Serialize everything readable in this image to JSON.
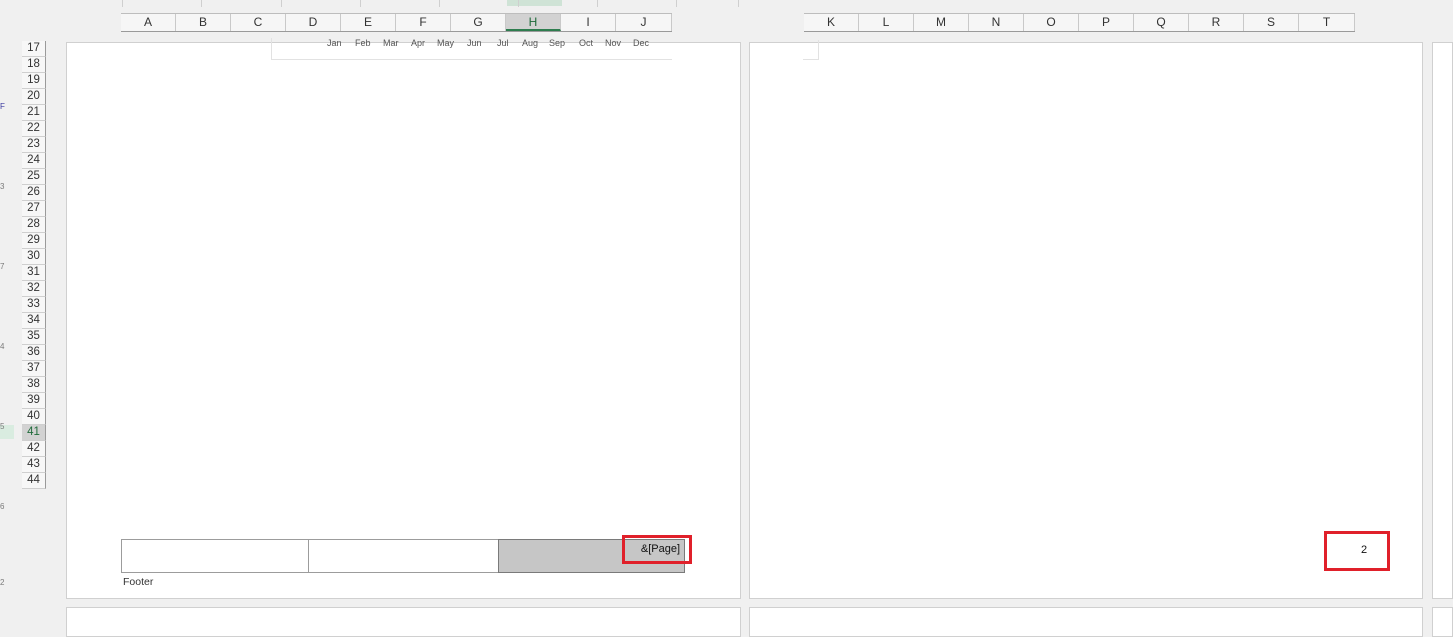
{
  "column_headers": {
    "left": [
      "A",
      "B",
      "C",
      "D",
      "E",
      "F",
      "G",
      "H",
      "I",
      "J"
    ],
    "right": [
      "K",
      "L",
      "M",
      "N",
      "O",
      "P",
      "Q",
      "R",
      "S",
      "T"
    ],
    "selected": "H"
  },
  "row_headers": [
    "17",
    "18",
    "19",
    "20",
    "21",
    "22",
    "23",
    "24",
    "25",
    "26",
    "27",
    "28",
    "29",
    "30",
    "31",
    "32",
    "33",
    "34",
    "35",
    "36",
    "37",
    "38",
    "39",
    "40",
    "41",
    "42",
    "43",
    "44"
  ],
  "selected_row": "41",
  "vertical_ruler_marks": [
    "F",
    "3",
    "7",
    "4",
    "5",
    "6",
    "2"
  ],
  "chart_axis_months": [
    "Jan",
    "Feb",
    "Mar",
    "Apr",
    "May",
    "Jun",
    "Jul",
    "Aug",
    "Sep",
    "Oct",
    "Nov",
    "Dec"
  ],
  "footer": {
    "label": "Footer",
    "right_section_field": "&[Page]",
    "page2_number": "2"
  },
  "highlight_color": "#e0202a"
}
